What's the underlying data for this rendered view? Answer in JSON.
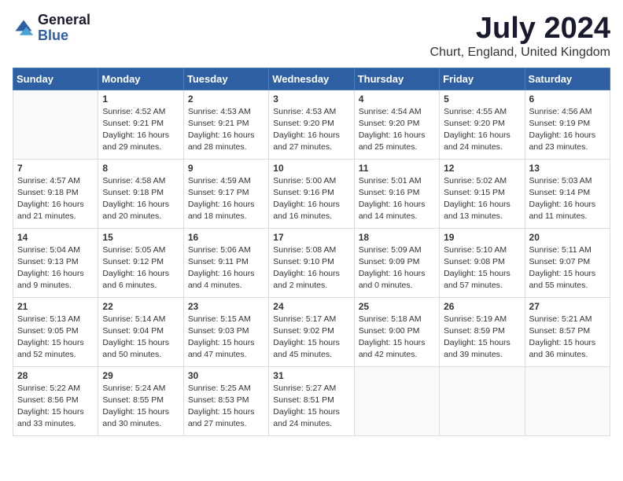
{
  "logo": {
    "general": "General",
    "blue": "Blue"
  },
  "title": "July 2024",
  "subtitle": "Churt, England, United Kingdom",
  "days_of_week": [
    "Sunday",
    "Monday",
    "Tuesday",
    "Wednesday",
    "Thursday",
    "Friday",
    "Saturday"
  ],
  "weeks": [
    [
      {
        "num": "",
        "sunrise": "",
        "sunset": "",
        "daylight": ""
      },
      {
        "num": "1",
        "sunrise": "Sunrise: 4:52 AM",
        "sunset": "Sunset: 9:21 PM",
        "daylight": "Daylight: 16 hours and 29 minutes."
      },
      {
        "num": "2",
        "sunrise": "Sunrise: 4:53 AM",
        "sunset": "Sunset: 9:21 PM",
        "daylight": "Daylight: 16 hours and 28 minutes."
      },
      {
        "num": "3",
        "sunrise": "Sunrise: 4:53 AM",
        "sunset": "Sunset: 9:20 PM",
        "daylight": "Daylight: 16 hours and 27 minutes."
      },
      {
        "num": "4",
        "sunrise": "Sunrise: 4:54 AM",
        "sunset": "Sunset: 9:20 PM",
        "daylight": "Daylight: 16 hours and 25 minutes."
      },
      {
        "num": "5",
        "sunrise": "Sunrise: 4:55 AM",
        "sunset": "Sunset: 9:20 PM",
        "daylight": "Daylight: 16 hours and 24 minutes."
      },
      {
        "num": "6",
        "sunrise": "Sunrise: 4:56 AM",
        "sunset": "Sunset: 9:19 PM",
        "daylight": "Daylight: 16 hours and 23 minutes."
      }
    ],
    [
      {
        "num": "7",
        "sunrise": "Sunrise: 4:57 AM",
        "sunset": "Sunset: 9:18 PM",
        "daylight": "Daylight: 16 hours and 21 minutes."
      },
      {
        "num": "8",
        "sunrise": "Sunrise: 4:58 AM",
        "sunset": "Sunset: 9:18 PM",
        "daylight": "Daylight: 16 hours and 20 minutes."
      },
      {
        "num": "9",
        "sunrise": "Sunrise: 4:59 AM",
        "sunset": "Sunset: 9:17 PM",
        "daylight": "Daylight: 16 hours and 18 minutes."
      },
      {
        "num": "10",
        "sunrise": "Sunrise: 5:00 AM",
        "sunset": "Sunset: 9:16 PM",
        "daylight": "Daylight: 16 hours and 16 minutes."
      },
      {
        "num": "11",
        "sunrise": "Sunrise: 5:01 AM",
        "sunset": "Sunset: 9:16 PM",
        "daylight": "Daylight: 16 hours and 14 minutes."
      },
      {
        "num": "12",
        "sunrise": "Sunrise: 5:02 AM",
        "sunset": "Sunset: 9:15 PM",
        "daylight": "Daylight: 16 hours and 13 minutes."
      },
      {
        "num": "13",
        "sunrise": "Sunrise: 5:03 AM",
        "sunset": "Sunset: 9:14 PM",
        "daylight": "Daylight: 16 hours and 11 minutes."
      }
    ],
    [
      {
        "num": "14",
        "sunrise": "Sunrise: 5:04 AM",
        "sunset": "Sunset: 9:13 PM",
        "daylight": "Daylight: 16 hours and 9 minutes."
      },
      {
        "num": "15",
        "sunrise": "Sunrise: 5:05 AM",
        "sunset": "Sunset: 9:12 PM",
        "daylight": "Daylight: 16 hours and 6 minutes."
      },
      {
        "num": "16",
        "sunrise": "Sunrise: 5:06 AM",
        "sunset": "Sunset: 9:11 PM",
        "daylight": "Daylight: 16 hours and 4 minutes."
      },
      {
        "num": "17",
        "sunrise": "Sunrise: 5:08 AM",
        "sunset": "Sunset: 9:10 PM",
        "daylight": "Daylight: 16 hours and 2 minutes."
      },
      {
        "num": "18",
        "sunrise": "Sunrise: 5:09 AM",
        "sunset": "Sunset: 9:09 PM",
        "daylight": "Daylight: 16 hours and 0 minutes."
      },
      {
        "num": "19",
        "sunrise": "Sunrise: 5:10 AM",
        "sunset": "Sunset: 9:08 PM",
        "daylight": "Daylight: 15 hours and 57 minutes."
      },
      {
        "num": "20",
        "sunrise": "Sunrise: 5:11 AM",
        "sunset": "Sunset: 9:07 PM",
        "daylight": "Daylight: 15 hours and 55 minutes."
      }
    ],
    [
      {
        "num": "21",
        "sunrise": "Sunrise: 5:13 AM",
        "sunset": "Sunset: 9:05 PM",
        "daylight": "Daylight: 15 hours and 52 minutes."
      },
      {
        "num": "22",
        "sunrise": "Sunrise: 5:14 AM",
        "sunset": "Sunset: 9:04 PM",
        "daylight": "Daylight: 15 hours and 50 minutes."
      },
      {
        "num": "23",
        "sunrise": "Sunrise: 5:15 AM",
        "sunset": "Sunset: 9:03 PM",
        "daylight": "Daylight: 15 hours and 47 minutes."
      },
      {
        "num": "24",
        "sunrise": "Sunrise: 5:17 AM",
        "sunset": "Sunset: 9:02 PM",
        "daylight": "Daylight: 15 hours and 45 minutes."
      },
      {
        "num": "25",
        "sunrise": "Sunrise: 5:18 AM",
        "sunset": "Sunset: 9:00 PM",
        "daylight": "Daylight: 15 hours and 42 minutes."
      },
      {
        "num": "26",
        "sunrise": "Sunrise: 5:19 AM",
        "sunset": "Sunset: 8:59 PM",
        "daylight": "Daylight: 15 hours and 39 minutes."
      },
      {
        "num": "27",
        "sunrise": "Sunrise: 5:21 AM",
        "sunset": "Sunset: 8:57 PM",
        "daylight": "Daylight: 15 hours and 36 minutes."
      }
    ],
    [
      {
        "num": "28",
        "sunrise": "Sunrise: 5:22 AM",
        "sunset": "Sunset: 8:56 PM",
        "daylight": "Daylight: 15 hours and 33 minutes."
      },
      {
        "num": "29",
        "sunrise": "Sunrise: 5:24 AM",
        "sunset": "Sunset: 8:55 PM",
        "daylight": "Daylight: 15 hours and 30 minutes."
      },
      {
        "num": "30",
        "sunrise": "Sunrise: 5:25 AM",
        "sunset": "Sunset: 8:53 PM",
        "daylight": "Daylight: 15 hours and 27 minutes."
      },
      {
        "num": "31",
        "sunrise": "Sunrise: 5:27 AM",
        "sunset": "Sunset: 8:51 PM",
        "daylight": "Daylight: 15 hours and 24 minutes."
      },
      {
        "num": "",
        "sunrise": "",
        "sunset": "",
        "daylight": ""
      },
      {
        "num": "",
        "sunrise": "",
        "sunset": "",
        "daylight": ""
      },
      {
        "num": "",
        "sunrise": "",
        "sunset": "",
        "daylight": ""
      }
    ]
  ]
}
